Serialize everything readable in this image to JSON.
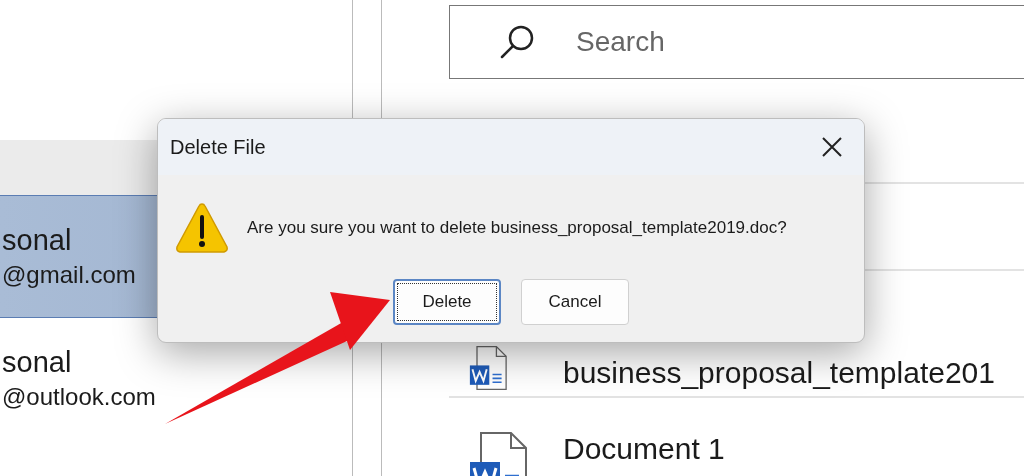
{
  "sidebar": {
    "accounts": [
      {
        "name": "sonal",
        "email": "@gmail.com",
        "selected": true
      },
      {
        "name": "sonal",
        "email": "@outlook.com",
        "selected": false
      }
    ]
  },
  "search": {
    "placeholder": "Search"
  },
  "files": [
    {
      "kind": "word",
      "name": "business_proposal_template201"
    },
    {
      "kind": "word",
      "name": "Document 1"
    }
  ],
  "dialog": {
    "title": "Delete File",
    "message": "Are you sure you want to delete business_proposal_template2019.doc?",
    "buttons": [
      {
        "label": "Delete",
        "focused": true
      },
      {
        "label": "Cancel",
        "focused": false
      }
    ]
  }
}
